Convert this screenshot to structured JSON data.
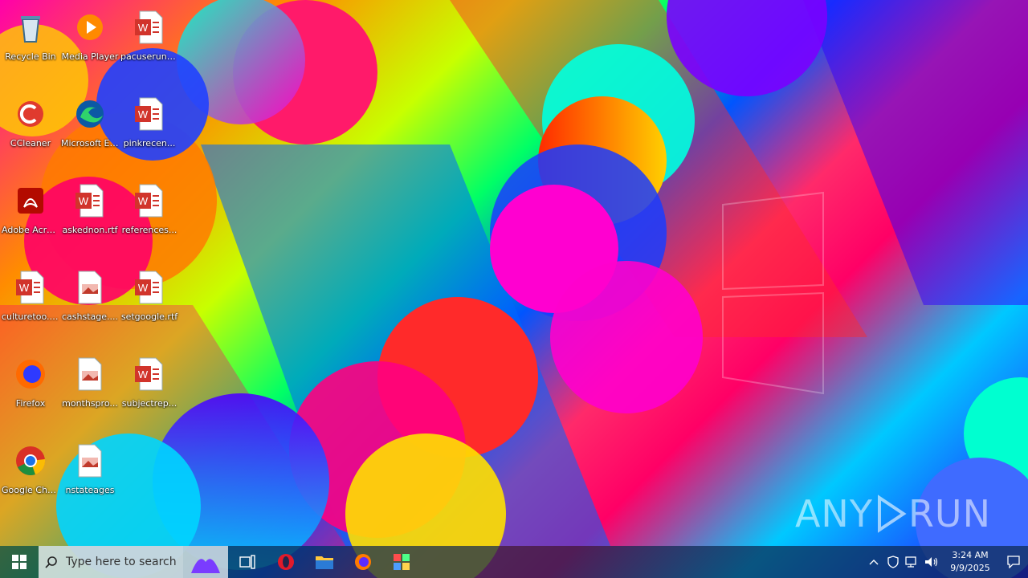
{
  "desktop": {
    "icons": [
      {
        "label": "Recycle Bin",
        "kind": "recycle-bin-icon"
      },
      {
        "label": "Media Player",
        "kind": "media-player-icon"
      },
      {
        "label": "pacuserun.rtf",
        "kind": "word-document-icon"
      },
      {
        "label": "CCleaner",
        "kind": "ccleaner-icon"
      },
      {
        "label": "Microsoft Edge",
        "kind": "edge-icon"
      },
      {
        "label": "pinkrecen...",
        "kind": "word-document-icon"
      },
      {
        "label": "Adobe Acrobat",
        "kind": "acrobat-icon"
      },
      {
        "label": "askednon.rtf",
        "kind": "word-document-icon"
      },
      {
        "label": "references...",
        "kind": "word-document-icon"
      },
      {
        "label": "culturetoo.rtf",
        "kind": "word-document-icon"
      },
      {
        "label": "cashstage....",
        "kind": "image-file-icon"
      },
      {
        "label": "setgoogle.rtf",
        "kind": "word-document-icon"
      },
      {
        "label": "Firefox",
        "kind": "firefox-icon"
      },
      {
        "label": "monthspro...",
        "kind": "image-file-icon"
      },
      {
        "label": "subjectrep...",
        "kind": "word-document-icon"
      },
      {
        "label": "Google Chrome",
        "kind": "chrome-icon"
      },
      {
        "label": "nstateages",
        "kind": "image-file-icon"
      }
    ]
  },
  "watermark": {
    "left": "ANY",
    "right": "RUN"
  },
  "taskbar": {
    "search_placeholder": "Type here to search",
    "pinned": [
      "task-view-icon",
      "opera-icon",
      "file-explorer-icon",
      "firefox-icon",
      "app-grid-icon"
    ],
    "clock": {
      "time": "3:24 AM",
      "date": "9/9/2025"
    }
  }
}
